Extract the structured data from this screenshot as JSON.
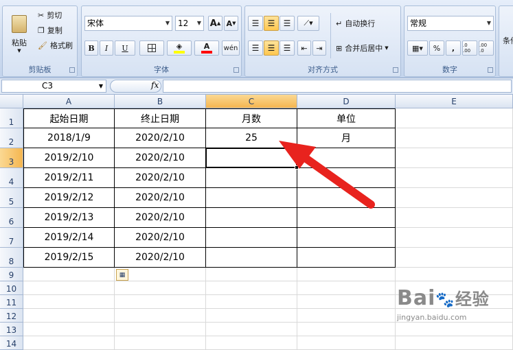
{
  "ribbon": {
    "clipboard": {
      "paste": "粘贴",
      "cut": "剪切",
      "copy": "复制",
      "format_painter": "格式刷",
      "label": "剪贴板"
    },
    "font": {
      "name": "宋体",
      "size": "12",
      "bold": "B",
      "italic": "I",
      "underline": "U",
      "grow": "A",
      "shrink": "A",
      "label": "字体"
    },
    "alignment": {
      "wrap": "自动换行",
      "merge": "合并后居中",
      "label": "对齐方式"
    },
    "number": {
      "format": "常规",
      "percent": "%",
      "comma": ",",
      "inc_dec": ".0 .00",
      "dec_dec": ".00 .0",
      "label": "数字"
    },
    "styles": {
      "conditional": "条件"
    }
  },
  "formula_bar": {
    "name_box": "C3",
    "fx": "fx",
    "content": ""
  },
  "columns": [
    "A",
    "B",
    "C",
    "D",
    "E"
  ],
  "selected_column": "C",
  "rows": [
    "1",
    "2",
    "3",
    "4",
    "5",
    "6",
    "7",
    "8",
    "9",
    "10",
    "11",
    "12",
    "13",
    "14"
  ],
  "selected_row": "3",
  "table": {
    "headers": [
      "起始日期",
      "终止日期",
      "月数",
      "单位"
    ],
    "data": [
      [
        "2018/1/9",
        "2020/2/10",
        "25",
        "月"
      ],
      [
        "2019/2/10",
        "2020/2/10",
        "",
        ""
      ],
      [
        "2019/2/11",
        "2020/2/10",
        "",
        ""
      ],
      [
        "2019/2/12",
        "2020/2/10",
        "",
        ""
      ],
      [
        "2019/2/13",
        "2020/2/10",
        "",
        ""
      ],
      [
        "2019/2/14",
        "2020/2/10",
        "",
        ""
      ],
      [
        "2019/2/15",
        "2020/2/10",
        "",
        ""
      ]
    ]
  },
  "annotation": {
    "arrow_color": "#e8231e"
  },
  "watermark": {
    "brand": "Bai",
    "brand2": "经验",
    "url": "jingyan.baidu.com"
  },
  "colors": {
    "ribbon": "#cfdcef",
    "selected_header": "#f5b650",
    "font_color_bar": "#ff0000",
    "highlight_bar": "#ffff00"
  }
}
